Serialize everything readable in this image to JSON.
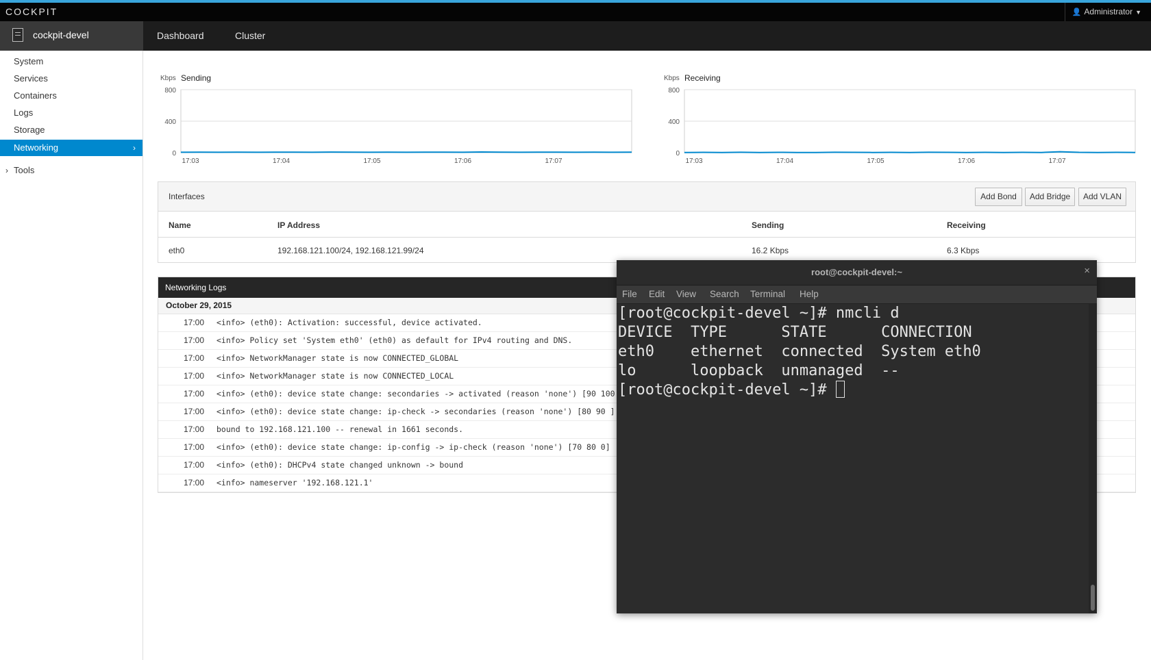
{
  "app": {
    "brand": "COCKPIT",
    "user": "Administrator"
  },
  "host": {
    "name": "cockpit-devel"
  },
  "nav_tabs": [
    "Dashboard",
    "Cluster"
  ],
  "sidebar": {
    "items": [
      "System",
      "Services",
      "Containers",
      "Logs",
      "Storage",
      "Networking"
    ],
    "active": "Networking",
    "tools": "Tools"
  },
  "charts": [
    {
      "title": "Sending",
      "unit": "Kbps",
      "y_ticks": [
        "800",
        "400",
        "0"
      ],
      "x_ticks": [
        "17:03",
        "17:04",
        "17:05",
        "17:06",
        "17:07"
      ],
      "ylim": [
        0,
        800
      ],
      "values": [
        5,
        6,
        5,
        7,
        5,
        6,
        6,
        5,
        8,
        6,
        5,
        6,
        5,
        7,
        6,
        5,
        9,
        6,
        5,
        6,
        7,
        5,
        6,
        5,
        6
      ]
    },
    {
      "title": "Receiving",
      "unit": "Kbps",
      "y_ticks": [
        "800",
        "400",
        "0"
      ],
      "x_ticks": [
        "17:03",
        "17:04",
        "17:05",
        "17:06",
        "17:07"
      ],
      "ylim": [
        0,
        800
      ],
      "values": [
        3,
        4,
        3,
        5,
        3,
        4,
        3,
        3,
        5,
        4,
        3,
        4,
        3,
        5,
        4,
        3,
        4,
        3,
        4,
        3,
        12,
        4,
        3,
        4,
        3
      ]
    }
  ],
  "interfaces": {
    "title": "Interfaces",
    "buttons": [
      "Add Bond",
      "Add Bridge",
      "Add VLAN"
    ],
    "columns": [
      "Name",
      "IP Address",
      "Sending",
      "Receiving"
    ],
    "rows": [
      {
        "name": "eth0",
        "ip": "192.168.121.100/24, 192.168.121.99/24",
        "sending": "16.2 Kbps",
        "receiving": "6.3 Kbps"
      }
    ]
  },
  "logs": {
    "title": "Networking Logs",
    "date": "October 29, 2015",
    "entries": [
      {
        "time": "17:00",
        "msg": "<info> (eth0): Activation: successful, device activated."
      },
      {
        "time": "17:00",
        "msg": "<info> Policy set 'System eth0' (eth0) as default for IPv4 routing and DNS."
      },
      {
        "time": "17:00",
        "msg": "<info> NetworkManager state is now CONNECTED_GLOBAL"
      },
      {
        "time": "17:00",
        "msg": "<info> NetworkManager state is now CONNECTED_LOCAL"
      },
      {
        "time": "17:00",
        "msg": "<info> (eth0): device state change: secondaries -> activated (reason 'none') [90 100"
      },
      {
        "time": "17:00",
        "msg": "<info> (eth0): device state change: ip-check -> secondaries (reason 'none') [80 90 ]"
      },
      {
        "time": "17:00",
        "msg": "bound to 192.168.121.100 -- renewal in 1661 seconds."
      },
      {
        "time": "17:00",
        "msg": "<info> (eth0): device state change: ip-config -> ip-check (reason 'none') [70 80 0]"
      },
      {
        "time": "17:00",
        "msg": "<info> (eth0): DHCPv4 state changed unknown -> bound"
      },
      {
        "time": "17:00",
        "msg": "<info> nameserver '192.168.121.1'"
      }
    ]
  },
  "terminal": {
    "title": "root@cockpit-devel:~",
    "close": "×",
    "menu": [
      "File",
      "Edit",
      "View",
      "Search",
      "Terminal",
      "Help"
    ],
    "lines": [
      "[root@cockpit-devel ~]# nmcli d",
      "DEVICE  TYPE      STATE      CONNECTION",
      "eth0    ethernet  connected  System eth0",
      "lo      loopback  unmanaged  --"
    ],
    "prompt": "[root@cockpit-devel ~]# "
  },
  "colors": {
    "accent": "#39a5dc",
    "active": "#0088ce",
    "series": "#0088ce"
  },
  "icons": {
    "user": "user-icon",
    "host": "server-icon",
    "chevron": "chevron-right-icon"
  }
}
